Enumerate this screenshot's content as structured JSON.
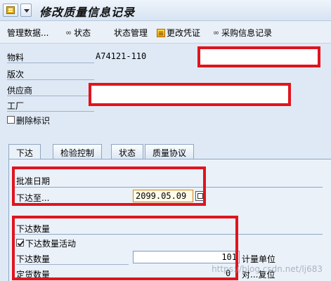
{
  "window": {
    "title": "修改质量信息记录"
  },
  "toolbar": {
    "items": [
      {
        "label": "管理数据..."
      },
      {
        "label": "状态",
        "icon": "glasses-icon"
      },
      {
        "label": "状态管理"
      },
      {
        "label": "更改凭证",
        "icon": "document-icon"
      },
      {
        "label": "采购信息记录",
        "icon": "glasses-icon"
      }
    ]
  },
  "header_fields": {
    "material": {
      "label": "物料",
      "value": "A74121-110"
    },
    "version": {
      "label": "版次"
    },
    "vendor": {
      "label": "供应商"
    },
    "plant": {
      "label": "工厂"
    },
    "deletion_flag": {
      "label": "删除标识",
      "checked": false
    }
  },
  "tabs": [
    {
      "label": "下达",
      "active": true
    },
    {
      "label": "检验控制",
      "active": false
    },
    {
      "label": "状态",
      "active": false
    },
    {
      "label": "质量协议",
      "active": false
    }
  ],
  "release_date_group": {
    "title": "批准日期",
    "release_until": {
      "label": "下达至...",
      "value": "2099.05.09"
    }
  },
  "release_qty_group": {
    "title": "下达数量",
    "qty_active": {
      "label": "下达数量活动",
      "checked": true
    },
    "release_qty": {
      "label": "下达数量",
      "value": "101",
      "unit_label": "计量单位"
    },
    "ordered_qty": {
      "label": "定货数量",
      "value": "0",
      "reset_label": "对...复位"
    }
  },
  "watermark": "https://blog.csdn.net/lj683"
}
